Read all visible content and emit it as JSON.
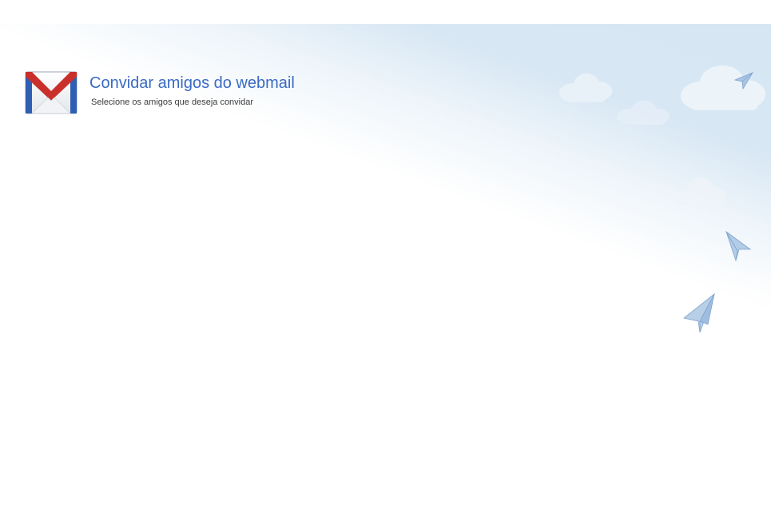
{
  "header": {
    "title": "Convidar amigos do webmail",
    "subtitle": "Selecione os amigos que deseja convidar",
    "icon": "gmail-envelope-icon"
  },
  "background": {
    "sky_color": "#d6e6f3",
    "decorations": [
      "cloud",
      "cloud",
      "cloud",
      "cloud",
      "paper-plane",
      "paper-plane",
      "paper-plane"
    ]
  },
  "colors": {
    "title": "#3a6bc4",
    "subtitle": "#3b3b3b",
    "envelope_red": "#c9302c",
    "envelope_blue": "#2f5fb3"
  }
}
